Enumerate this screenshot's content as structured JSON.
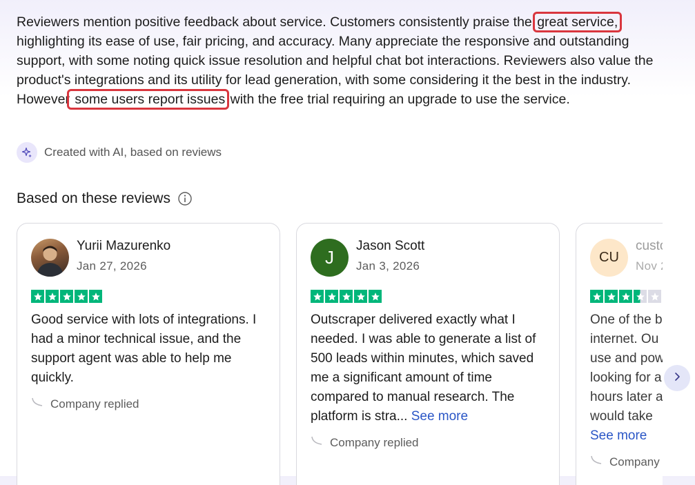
{
  "summary": {
    "part1": "Reviewers mention positive feedback about service. Customers consistently praise the ",
    "highlight1": "great service,",
    "part2": " highlighting its ease of use, fair pricing, and accuracy. Many appreciate the responsive and outstanding support, with some noting quick issue resolution and helpful chat bot interactions. Reviewers also value the product's integrations and its utility for lead generation, with some considering it the best in the industry. However",
    "highlight2": " some users report issues",
    "part3": " with the free trial requiring an upgrade to use the service."
  },
  "ai_note": {
    "label": "Created with AI, based on reviews",
    "icon": "sparkle-icon"
  },
  "section": {
    "title": "Based on these reviews",
    "icon": "info-icon"
  },
  "reviews": [
    {
      "name": "Yurii Mazurenko",
      "date": "Jan 27, 2026",
      "rating": 5,
      "text": "Good service with lots of integrations. I had a minor technical issue, and the support agent was able to help me quickly.",
      "see_more": "",
      "replied": "Company replied"
    },
    {
      "name": "Jason Scott",
      "avatar_letter": "J",
      "date": "Jan 3, 2026",
      "rating": 5,
      "text": "Outscraper delivered exactly what I needed. I was able to generate a list of 500 leads within minutes, which saved me a significant amount of time compared to manual research. The platform is stra...",
      "see_more": "See more",
      "replied": "Company replied"
    },
    {
      "name": "custo",
      "avatar_initials": "CU",
      "date": "Nov 2",
      "rating": 3.5,
      "text": "One of the b internet. Ou use and pow looking for a hours later a would take",
      "see_more": "See more",
      "replied": "Company"
    }
  ],
  "colors": {
    "star": "#00b67a",
    "highlight_border": "#d9363e",
    "link": "#2a56c6"
  },
  "navigation": {
    "next_icon": "chevron-right-icon"
  }
}
